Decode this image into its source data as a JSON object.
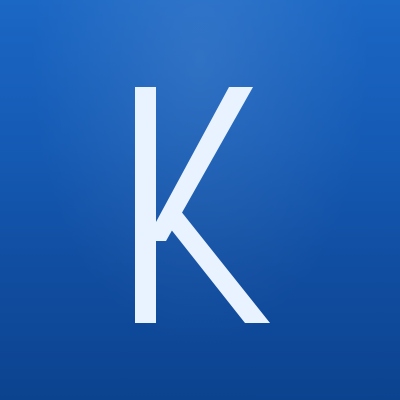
{
  "avatar": {
    "initial": "K",
    "background_top": "#1b67c4",
    "background_bottom": "#0c438f",
    "letter_color": "#e8f3ff"
  }
}
